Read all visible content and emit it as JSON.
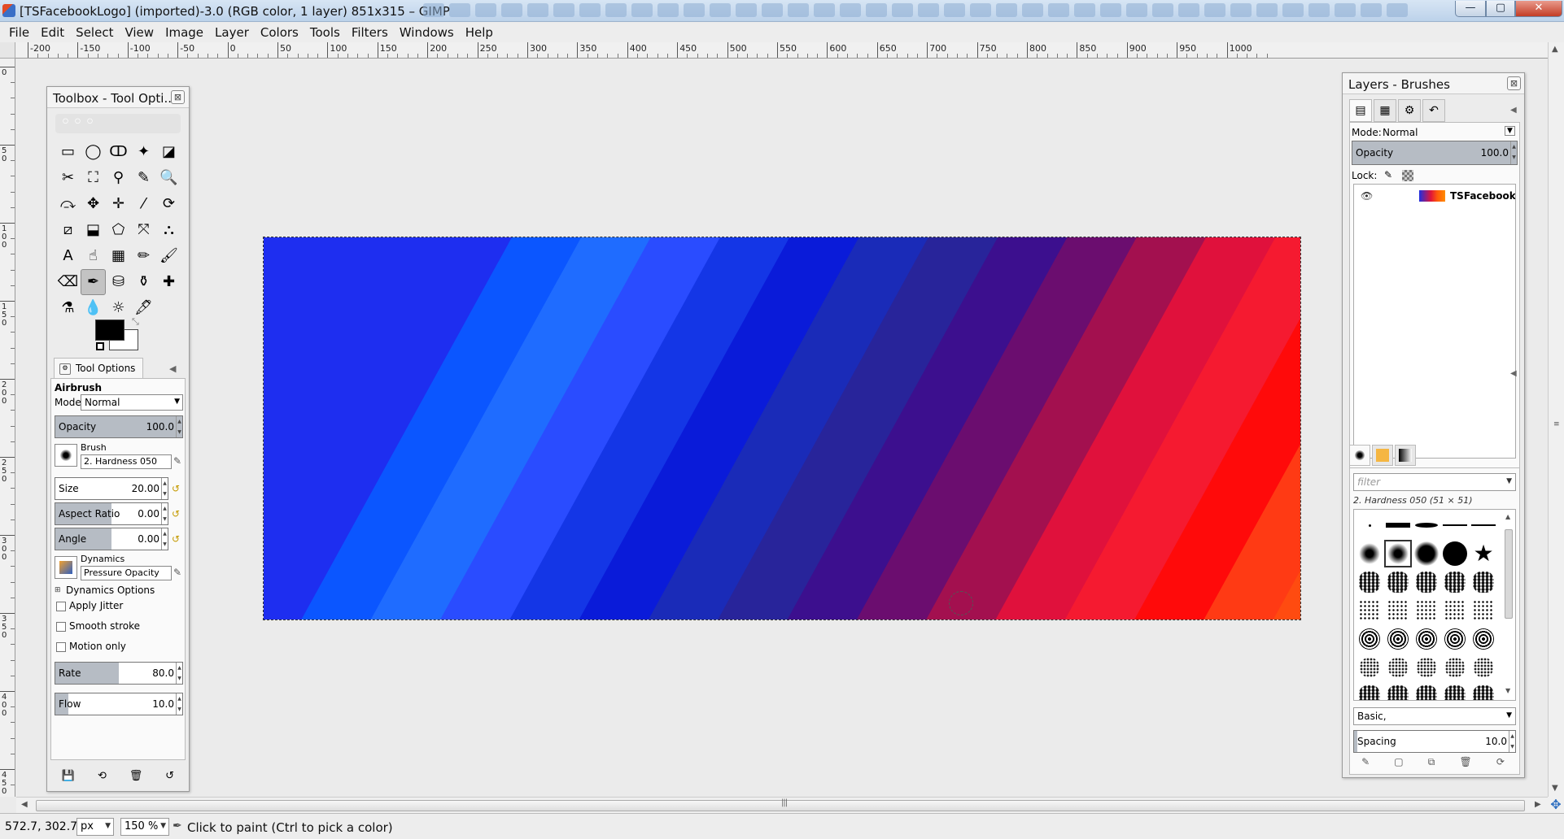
{
  "window": {
    "title": "[TSFacebookLogo] (imported)-3.0 (RGB color, 1 layer) 851x315 – GIMP",
    "min": "—",
    "max": "▢",
    "close": "✕"
  },
  "menu": [
    "File",
    "Edit",
    "Select",
    "View",
    "Image",
    "Layer",
    "Colors",
    "Tools",
    "Filters",
    "Windows",
    "Help"
  ],
  "ruler": {
    "h": [
      "-200",
      "-150",
      "-100",
      "-50",
      "0",
      "50",
      "100",
      "150",
      "200",
      "250",
      "300",
      "350",
      "400",
      "450",
      "500",
      "550",
      "600",
      "650",
      "700",
      "750",
      "800",
      "850",
      "900",
      "950",
      "1000"
    ],
    "v": [
      "0",
      "5\n0",
      "1\n0\n0",
      "1\n5\n0",
      "2\n0\n0",
      "2\n5\n0",
      "3\n0\n0",
      "3\n5\n0",
      "4\n0\n0",
      "4\n5\n0"
    ]
  },
  "toolbox": {
    "title": "Toolbox - Tool Opti...",
    "close": "⊠",
    "tools": [
      "▭",
      "◯",
      "ↀ",
      "✦",
      "◪",
      "✂",
      "⛶",
      "⚲",
      "✎",
      "🔍",
      "⤼",
      "✥",
      "✛",
      "⁄",
      "⟳",
      "⧄",
      "⬓",
      "⬠",
      "⤧",
      "⛬",
      "A",
      "☝",
      "▦",
      "✏",
      "🖌",
      "⌫",
      "✒",
      "⛁",
      "⚱",
      "✚",
      "⚗",
      "💧",
      "☼",
      "🖋",
      ""
    ],
    "tool_names": [
      "rect-select-icon",
      "ellipse-select-icon",
      "free-select-icon",
      "fuzzy-select-icon",
      "color-select-icon",
      "scissors-icon",
      "foreground-select-icon",
      "paths-icon",
      "color-picker-icon",
      "zoom-icon",
      "measure-icon",
      "move-icon",
      "align-icon",
      "crop-icon",
      "rotate-icon",
      "scale-icon",
      "shear-icon",
      "perspective-icon",
      "flip-icon",
      "cage-icon",
      "text-icon",
      "bucket-fill-icon",
      "blend-icon",
      "pencil-icon",
      "paintbrush-icon",
      "eraser-icon",
      "airbrush-icon",
      "ink-icon",
      "clone-icon",
      "heal-icon",
      "perspective-clone-icon",
      "blur-icon",
      "dodge-burn-icon",
      "smudge-icon",
      ""
    ],
    "active_tool": 26,
    "wilber": "◦◦◦",
    "fg_color": "#000000",
    "bg_color": "#ffffff"
  },
  "tool_options": {
    "tab_label": "Tool Options",
    "tool_name": "Airbrush",
    "mode_label": "Mode:",
    "mode_value": "Normal",
    "opacity": {
      "label": "Opacity",
      "value": "100.0",
      "fraction": 1.0
    },
    "brush_label": "Brush",
    "brush_value": "2. Hardness 050",
    "size": {
      "label": "Size",
      "value": "20.00",
      "fraction": 0.0
    },
    "aspect": {
      "label": "Aspect Ratio",
      "value": "0.00",
      "fraction": 0.5
    },
    "angle": {
      "label": "Angle",
      "value": "0.00",
      "fraction": 0.5
    },
    "dynamics_label": "Dynamics",
    "dynamics_value": "Pressure Opacity",
    "dynamics_options": "Dynamics Options",
    "apply_jitter": "Apply Jitter",
    "smooth_stroke": "Smooth stroke",
    "motion_only": "Motion only",
    "rate": {
      "label": "Rate",
      "value": "80.0",
      "fraction": 0.5
    },
    "flow": {
      "label": "Flow",
      "value": "10.0",
      "fraction": 0.1
    },
    "footer_icons": [
      "💾",
      "⟲",
      "🗑",
      "↺"
    ]
  },
  "layers_dock": {
    "title": "Layers - Brushes",
    "close": "⊠",
    "tabs": [
      "▤",
      "▦",
      "⚙",
      "↶"
    ],
    "mode_label": "Mode:",
    "mode_value": "Normal",
    "opacity": {
      "label": "Opacity",
      "value": "100.0",
      "fraction": 1.0
    },
    "lock_label": "Lock:",
    "layer_name": "TSFacebookLogo",
    "layer_actions": [
      "▢",
      "📁",
      "▲",
      "▼",
      "⧉",
      "⚓",
      "🗑"
    ],
    "brush_filter": "filter",
    "brush_current": "2. Hardness 050 (51 × 51)",
    "brush_tag": "Basic,",
    "spacing": {
      "label": "Spacing",
      "value": "10.0",
      "fraction": 0.02
    },
    "brush_actions": [
      "✎",
      "▢",
      "⧉",
      "🗑",
      "⟳"
    ]
  },
  "status": {
    "coords": "572.7, 302.7",
    "unit": "px",
    "zoom": "150 %",
    "message": "Click to paint (Ctrl to pick a color)"
  },
  "image_colors": [
    "#1e2ef0",
    "#0b56ff",
    "#1f6cff",
    "#2a4cff",
    "#1436e6",
    "#0a1bd9",
    "#1a2bb8",
    "#28249a",
    "#3c0f8e",
    "#6b0d6f",
    "#a3104f",
    "#e0113c",
    "#f51a30",
    "#ff0a0a",
    "#ff3a14",
    "#ff4b10",
    "#ff5a0c",
    "#ff6a0a",
    "#ff7808",
    "#ff8606",
    "#ff9206"
  ]
}
